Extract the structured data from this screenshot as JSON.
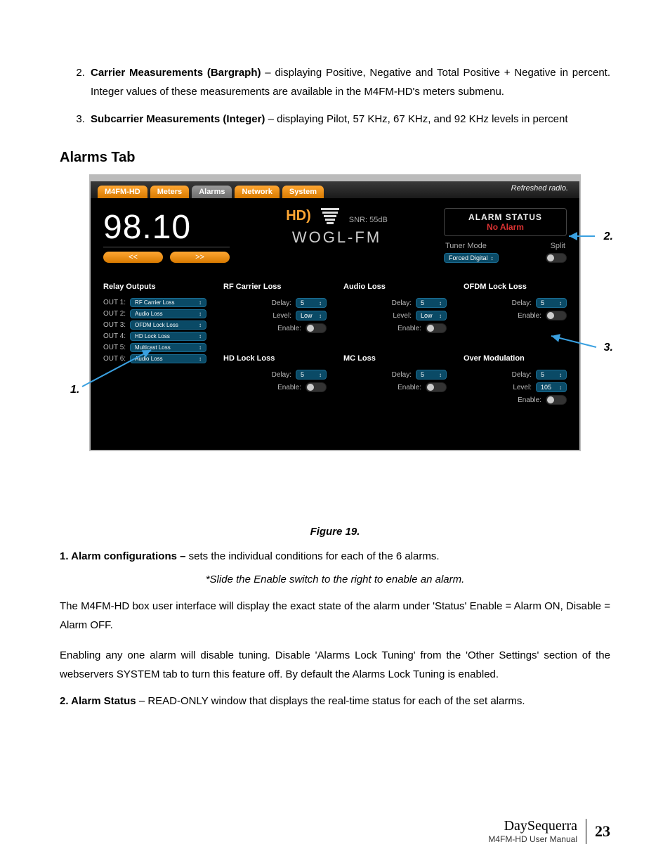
{
  "list": {
    "two_title": "Carrier Measurements (Bargraph)",
    "two_body": " – displaying Positive, Negative and Total Positive + Negative in percent.  Integer values of these measurements are available in the M4FM-HD's meters submenu.",
    "three_title": "Subcarrier Measurements (Integer)",
    "three_body": " – displaying Pilot, 57 KHz, 67 KHz, and 92 KHz levels in percent"
  },
  "heading": "Alarms Tab",
  "ui": {
    "tabs": {
      "t1": "M4FM-HD",
      "t2": "Meters",
      "t3": "Alarms",
      "t4": "Network",
      "t5": "System"
    },
    "refreshed": "Refreshed radio.",
    "freq": "98.10",
    "prev": "<<",
    "next": ">>",
    "snr": "SNR: 55dB",
    "station": "WOGL-FM",
    "alarm_status_t": "ALARM STATUS",
    "alarm_status_v": "No Alarm",
    "tuner_mode_l": "Tuner Mode",
    "tuner_mode_r": "Split",
    "tuner_sel": "Forced Digital",
    "cols": {
      "rf": {
        "title": "RF Carrier Loss",
        "delay": "Delay:",
        "delay_v": "5",
        "level": "Level:",
        "level_v": "Low",
        "enable": "Enable:"
      },
      "aud": {
        "title": "Audio Loss",
        "delay": "Delay:",
        "delay_v": "5",
        "level": "Level:",
        "level_v": "Low",
        "enable": "Enable:"
      },
      "ofdm": {
        "title": "OFDM Lock Loss",
        "delay": "Delay:",
        "delay_v": "5",
        "enable": "Enable:"
      },
      "relay": {
        "title": "Relay Outputs",
        "o1": "OUT 1:",
        "o1v": "RF Carrier Loss",
        "o2": "OUT 2:",
        "o2v": "Audio Loss",
        "o3": "OUT 3:",
        "o3v": "OFDM Lock Loss",
        "o4": "OUT 4:",
        "o4v": "HD Lock Loss",
        "o5": "OUT 5:",
        "o5v": "Multicast Loss",
        "o6": "OUT 6:",
        "o6v": "Audio Loss"
      },
      "hd": {
        "title": "HD Lock Loss",
        "delay": "Delay:",
        "delay_v": "5",
        "enable": "Enable:"
      },
      "mc": {
        "title": "MC Loss",
        "delay": "Delay:",
        "delay_v": "5",
        "enable": "Enable:"
      },
      "om": {
        "title": "Over Modulation",
        "delay": "Delay:",
        "delay_v": "5",
        "level": "Level:",
        "level_v": "105",
        "enable": "Enable:"
      }
    }
  },
  "callout1": "1.",
  "callout2": "2.",
  "callout3": "3.",
  "caption": "Figure 19.",
  "body": {
    "p1a": "1. Alarm configurations –",
    "p1b": " sets the individual conditions for each of the 6 alarms.",
    "p2": "*Slide the Enable switch to the right to enable an alarm.",
    "p3": "The M4FM-HD box user interface will display the exact state of the alarm under 'Status' Enable = Alarm ON, Disable = Alarm OFF.",
    "p4": "Enabling any one alarm will disable tuning.  Disable 'Alarms Lock Tuning' from the 'Other Settings' section of the webservers SYSTEM tab to turn this feature off.  By default the Alarms Lock Tuning is enabled.",
    "p5a": "2.  Alarm Status",
    "p5b": " – READ-ONLY window that displays the real-time status for each of the set alarms."
  },
  "footer": {
    "brand": "DaySequerra",
    "sub": "M4FM-HD User Manual",
    "page": "23"
  }
}
